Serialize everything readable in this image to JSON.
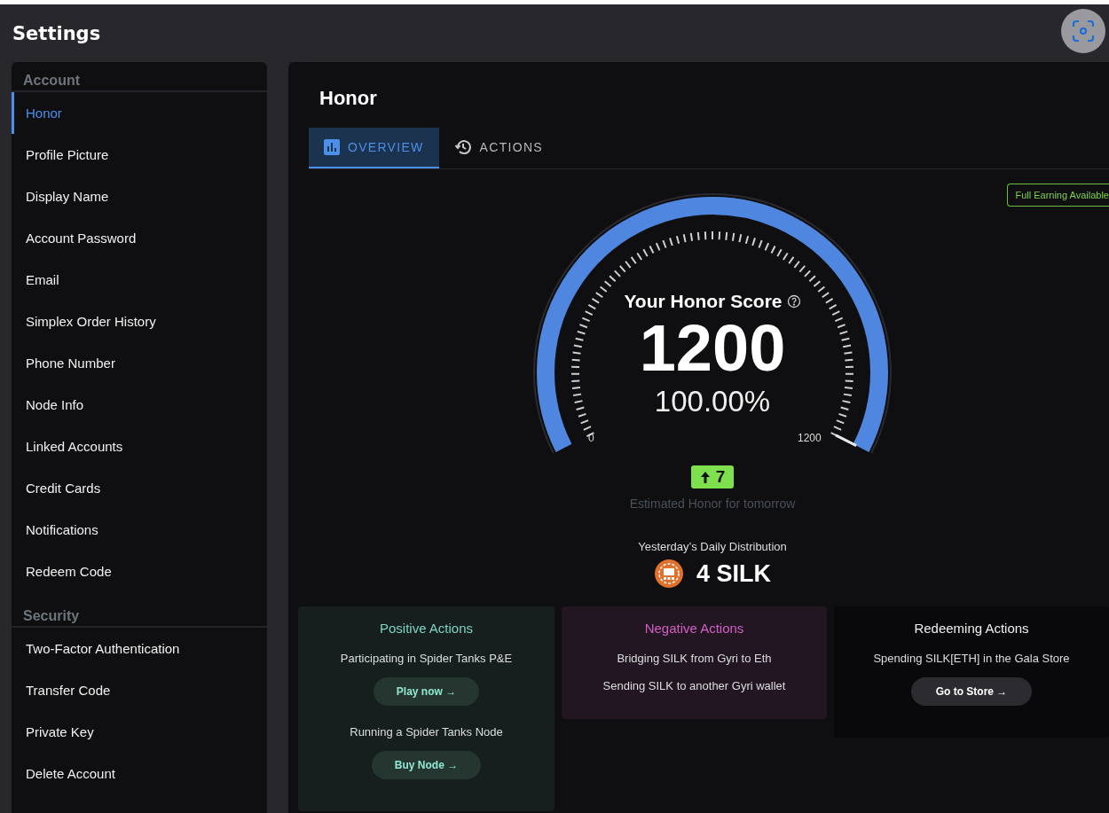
{
  "window": {
    "title": "Settings"
  },
  "sidebar": {
    "sections": [
      {
        "heading": "Account",
        "items": [
          {
            "label": "Honor",
            "selected": true
          },
          {
            "label": "Profile Picture",
            "selected": false
          },
          {
            "label": "Display Name",
            "selected": false
          },
          {
            "label": "Account Password",
            "selected": false
          },
          {
            "label": "Email",
            "selected": false
          },
          {
            "label": "Simplex Order History",
            "selected": false
          },
          {
            "label": "Phone Number",
            "selected": false
          },
          {
            "label": "Node Info",
            "selected": false
          },
          {
            "label": "Linked Accounts",
            "selected": false
          },
          {
            "label": "Credit Cards",
            "selected": false
          },
          {
            "label": "Notifications",
            "selected": false
          },
          {
            "label": "Redeem Code",
            "selected": false
          }
        ]
      },
      {
        "heading": "Security",
        "items": [
          {
            "label": "Two-Factor Authentication",
            "selected": false
          },
          {
            "label": "Transfer Code",
            "selected": false
          },
          {
            "label": "Private Key",
            "selected": false
          },
          {
            "label": "Delete Account",
            "selected": false
          }
        ]
      }
    ]
  },
  "content": {
    "title": "Honor",
    "tabs": [
      {
        "label": "OVERVIEW",
        "kind": "chart",
        "selected": true
      },
      {
        "label": "ACTIONS",
        "kind": "history",
        "selected": false
      }
    ],
    "badge": "Full Earning Available",
    "gauge": {
      "title": "Your Honor Score",
      "score": "1200",
      "percent": "100.00%",
      "min_label": "0",
      "max_label": "1200",
      "level": 1
    },
    "estimate": {
      "change": "7",
      "caption": "Estimated Honor for tomorrow"
    },
    "distribution": {
      "label": "Yesterday’s Daily Distribution",
      "amount": "4 SILK"
    },
    "action_cards": [
      {
        "kind": "positive",
        "title": "Positive Actions",
        "entries": [
          {
            "text": "Participating in Spider Tanks P&E",
            "button": "Play now →"
          },
          {
            "text": "Running a Spider Tanks Node",
            "button": "Buy Node →"
          }
        ]
      },
      {
        "kind": "negative",
        "title": "Negative Actions",
        "entries": [
          {
            "text": "Bridging SILK from Gyri to Eth"
          },
          {
            "text": "Sending SILK to another Gyri wallet"
          }
        ]
      },
      {
        "kind": "redeeming",
        "title": "Redeeming Actions",
        "entries": [
          {
            "text": "Spending SILK[ETH] in the Gala Store",
            "button": "Go to Store →"
          }
        ]
      }
    ]
  }
}
